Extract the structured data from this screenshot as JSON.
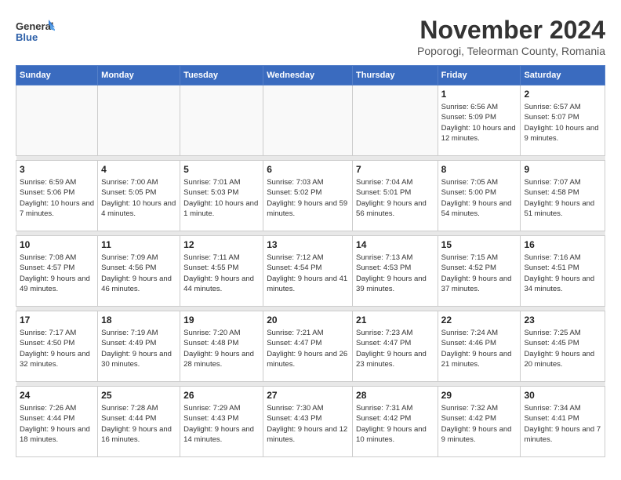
{
  "header": {
    "logo_general": "General",
    "logo_blue": "Blue",
    "month_title": "November 2024",
    "location": "Poporogi, Teleorman County, Romania"
  },
  "weekdays": [
    "Sunday",
    "Monday",
    "Tuesday",
    "Wednesday",
    "Thursday",
    "Friday",
    "Saturday"
  ],
  "weeks": [
    [
      {
        "day": "",
        "info": ""
      },
      {
        "day": "",
        "info": ""
      },
      {
        "day": "",
        "info": ""
      },
      {
        "day": "",
        "info": ""
      },
      {
        "day": "",
        "info": ""
      },
      {
        "day": "1",
        "info": "Sunrise: 6:56 AM\nSunset: 5:09 PM\nDaylight: 10 hours and 12 minutes."
      },
      {
        "day": "2",
        "info": "Sunrise: 6:57 AM\nSunset: 5:07 PM\nDaylight: 10 hours and 9 minutes."
      }
    ],
    [
      {
        "day": "3",
        "info": "Sunrise: 6:59 AM\nSunset: 5:06 PM\nDaylight: 10 hours and 7 minutes."
      },
      {
        "day": "4",
        "info": "Sunrise: 7:00 AM\nSunset: 5:05 PM\nDaylight: 10 hours and 4 minutes."
      },
      {
        "day": "5",
        "info": "Sunrise: 7:01 AM\nSunset: 5:03 PM\nDaylight: 10 hours and 1 minute."
      },
      {
        "day": "6",
        "info": "Sunrise: 7:03 AM\nSunset: 5:02 PM\nDaylight: 9 hours and 59 minutes."
      },
      {
        "day": "7",
        "info": "Sunrise: 7:04 AM\nSunset: 5:01 PM\nDaylight: 9 hours and 56 minutes."
      },
      {
        "day": "8",
        "info": "Sunrise: 7:05 AM\nSunset: 5:00 PM\nDaylight: 9 hours and 54 minutes."
      },
      {
        "day": "9",
        "info": "Sunrise: 7:07 AM\nSunset: 4:58 PM\nDaylight: 9 hours and 51 minutes."
      }
    ],
    [
      {
        "day": "10",
        "info": "Sunrise: 7:08 AM\nSunset: 4:57 PM\nDaylight: 9 hours and 49 minutes."
      },
      {
        "day": "11",
        "info": "Sunrise: 7:09 AM\nSunset: 4:56 PM\nDaylight: 9 hours and 46 minutes."
      },
      {
        "day": "12",
        "info": "Sunrise: 7:11 AM\nSunset: 4:55 PM\nDaylight: 9 hours and 44 minutes."
      },
      {
        "day": "13",
        "info": "Sunrise: 7:12 AM\nSunset: 4:54 PM\nDaylight: 9 hours and 41 minutes."
      },
      {
        "day": "14",
        "info": "Sunrise: 7:13 AM\nSunset: 4:53 PM\nDaylight: 9 hours and 39 minutes."
      },
      {
        "day": "15",
        "info": "Sunrise: 7:15 AM\nSunset: 4:52 PM\nDaylight: 9 hours and 37 minutes."
      },
      {
        "day": "16",
        "info": "Sunrise: 7:16 AM\nSunset: 4:51 PM\nDaylight: 9 hours and 34 minutes."
      }
    ],
    [
      {
        "day": "17",
        "info": "Sunrise: 7:17 AM\nSunset: 4:50 PM\nDaylight: 9 hours and 32 minutes."
      },
      {
        "day": "18",
        "info": "Sunrise: 7:19 AM\nSunset: 4:49 PM\nDaylight: 9 hours and 30 minutes."
      },
      {
        "day": "19",
        "info": "Sunrise: 7:20 AM\nSunset: 4:48 PM\nDaylight: 9 hours and 28 minutes."
      },
      {
        "day": "20",
        "info": "Sunrise: 7:21 AM\nSunset: 4:47 PM\nDaylight: 9 hours and 26 minutes."
      },
      {
        "day": "21",
        "info": "Sunrise: 7:23 AM\nSunset: 4:47 PM\nDaylight: 9 hours and 23 minutes."
      },
      {
        "day": "22",
        "info": "Sunrise: 7:24 AM\nSunset: 4:46 PM\nDaylight: 9 hours and 21 minutes."
      },
      {
        "day": "23",
        "info": "Sunrise: 7:25 AM\nSunset: 4:45 PM\nDaylight: 9 hours and 20 minutes."
      }
    ],
    [
      {
        "day": "24",
        "info": "Sunrise: 7:26 AM\nSunset: 4:44 PM\nDaylight: 9 hours and 18 minutes."
      },
      {
        "day": "25",
        "info": "Sunrise: 7:28 AM\nSunset: 4:44 PM\nDaylight: 9 hours and 16 minutes."
      },
      {
        "day": "26",
        "info": "Sunrise: 7:29 AM\nSunset: 4:43 PM\nDaylight: 9 hours and 14 minutes."
      },
      {
        "day": "27",
        "info": "Sunrise: 7:30 AM\nSunset: 4:43 PM\nDaylight: 9 hours and 12 minutes."
      },
      {
        "day": "28",
        "info": "Sunrise: 7:31 AM\nSunset: 4:42 PM\nDaylight: 9 hours and 10 minutes."
      },
      {
        "day": "29",
        "info": "Sunrise: 7:32 AM\nSunset: 4:42 PM\nDaylight: 9 hours and 9 minutes."
      },
      {
        "day": "30",
        "info": "Sunrise: 7:34 AM\nSunset: 4:41 PM\nDaylight: 9 hours and 7 minutes."
      }
    ]
  ]
}
